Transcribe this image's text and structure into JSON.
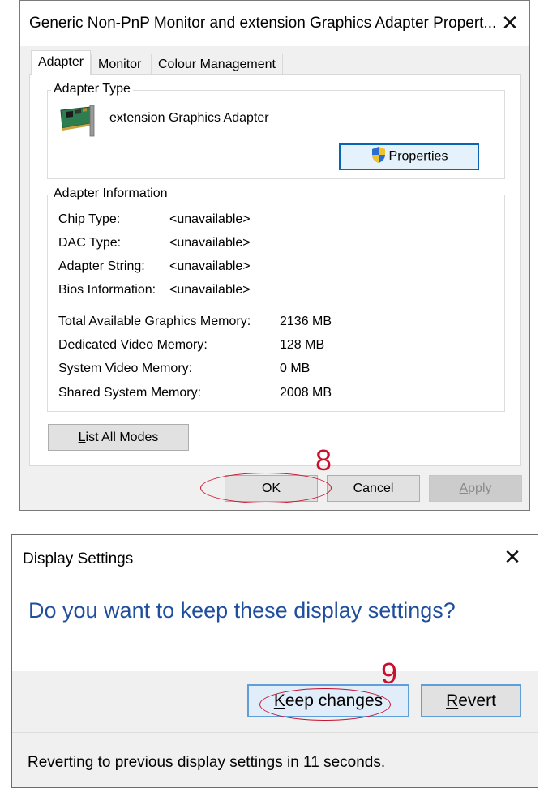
{
  "adapter_dialog": {
    "title": "Generic Non-PnP Monitor and extension Graphics Adapter Propert...",
    "close_glyph": "✕",
    "tabs": [
      {
        "label": "Adapter",
        "active": true
      },
      {
        "label": "Monitor",
        "active": false
      },
      {
        "label": "Colour Management",
        "active": false
      }
    ],
    "adapter_type": {
      "group_label": "Adapter Type",
      "adapter_name": "extension Graphics Adapter",
      "icon": "graphics-card-icon",
      "properties_button": {
        "mnemonic": "P",
        "rest": "roperties",
        "icon": "uac-shield-icon"
      }
    },
    "adapter_info": {
      "group_label": "Adapter Information",
      "rows": [
        {
          "label": "Chip Type:",
          "value": "<unavailable>"
        },
        {
          "label": "DAC Type:",
          "value": "<unavailable>"
        },
        {
          "label": "Adapter String:",
          "value": "<unavailable>"
        },
        {
          "label": "Bios Information:",
          "value": "<unavailable>"
        }
      ],
      "memory_rows": [
        {
          "label": "Total Available Graphics Memory:",
          "value": "2136 MB"
        },
        {
          "label": "Dedicated Video Memory:",
          "value": "128 MB"
        },
        {
          "label": "System Video Memory:",
          "value": "0 MB"
        },
        {
          "label": "Shared System Memory:",
          "value": "2008 MB"
        }
      ]
    },
    "list_modes_button": {
      "mnemonic": "L",
      "rest": "ist All Modes"
    },
    "ok_label": "OK",
    "cancel_label": "Cancel",
    "apply_button": {
      "mnemonic": "A",
      "rest": "pply",
      "enabled": false
    },
    "annotation_number": "8"
  },
  "display_dialog": {
    "title": "Display Settings",
    "close_glyph": "✕",
    "question": "Do you want to keep these display settings?",
    "keep_button": {
      "mnemonic": "K",
      "rest": "eep changes"
    },
    "revert_button": {
      "mnemonic": "R",
      "rest": "evert"
    },
    "countdown": "Reverting to previous display settings in 11 seconds.",
    "annotation_number": "9"
  },
  "colors": {
    "accent_focus": "#0a64b4",
    "question_text": "#1f4e9c",
    "annotation_red": "#c8102e"
  }
}
